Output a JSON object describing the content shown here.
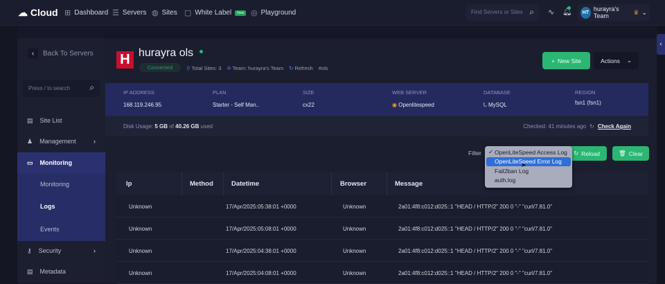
{
  "topbar": {
    "logo": "Cloud",
    "nav": [
      {
        "label": "Dashboard",
        "icon": "dashboard-icon"
      },
      {
        "label": "Servers",
        "icon": "servers-icon"
      },
      {
        "label": "Sites",
        "icon": "globe-icon"
      },
      {
        "label": "White Label",
        "icon": "white-label-icon",
        "badge": "New"
      },
      {
        "label": "Playground",
        "icon": "playground-icon"
      }
    ],
    "search_placeholder": "Find Servers or Sites",
    "avatar_initials": "HT",
    "team": "hurayra's Team"
  },
  "sidebar": {
    "back": "Back To Servers",
    "search_placeholder": "Press / to search",
    "items": [
      {
        "label": "Site List"
      },
      {
        "label": "Management"
      },
      {
        "label": "Monitoring"
      },
      {
        "label": "Security"
      },
      {
        "label": "Metadata"
      }
    ],
    "sub": [
      "Monitoring",
      "Logs",
      "Events"
    ]
  },
  "server": {
    "initial": "H",
    "name": "hurayra ols",
    "status": "Connected",
    "total_sites": "Total Sites: 3",
    "team": "Team: hurayra's Team",
    "refresh": "Refresh",
    "tag": "#ols",
    "new_site": "New Site",
    "actions": "Actions"
  },
  "info": {
    "ip_label": "IP ADDRESS",
    "ip": "168.119.246.95",
    "plan_label": "PLAN",
    "plan": "Starter - Self Man..",
    "size_label": "SIZE",
    "size": "cx22",
    "web_label": "WEB SERVER",
    "web": "Openlitespeed",
    "db_label": "DATABASE",
    "db": "MySQL",
    "region_label": "REGION",
    "region": "fsn1 (fsn1)"
  },
  "disk": {
    "prefix": "Disk Usage:",
    "used": "5 GB",
    "of": "of",
    "total": "40.26 GB",
    "suffix": "used",
    "checked": "Checked: 41 minutes ago",
    "check_again": "Check Again"
  },
  "logs": {
    "filter_label": "Filter",
    "options": [
      "OpenLiteSpeed Access Log",
      "OpenLiteSpeed Error Log",
      "Fail2ban Log",
      "auth.log"
    ],
    "checked_index": 0,
    "highlighted_index": 1,
    "reload": "Reload",
    "clear": "Clear",
    "columns": [
      "Ip",
      "Method",
      "Datetime",
      "Browser",
      "Message"
    ],
    "rows": [
      [
        "Unknown",
        "",
        "17/Apr/2025:05:38:01 +0000",
        "Unknown",
        "2a01:4f8:c012:d025::1 \"HEAD / HTTP/2\" 200 0 \"-\" \"curl/7.81.0\""
      ],
      [
        "Unknown",
        "",
        "17/Apr/2025:05:08:01 +0000",
        "Unknown",
        "2a01:4f8:c012:d025::1 \"HEAD / HTTP/2\" 200 0 \"-\" \"curl/7.81.0\""
      ],
      [
        "Unknown",
        "",
        "17/Apr/2025:04:38:01 +0000",
        "Unknown",
        "2a01:4f8:c012:d025::1 \"HEAD / HTTP/2\" 200 0 \"-\" \"curl/7.81.0\""
      ],
      [
        "Unknown",
        "",
        "17/Apr/2025:04:08:01 +0000",
        "Unknown",
        "2a01:4f8:c012:d025::1 \"HEAD / HTTP/2\" 200 0 \"-\" \"curl/7.81.0\""
      ]
    ]
  }
}
